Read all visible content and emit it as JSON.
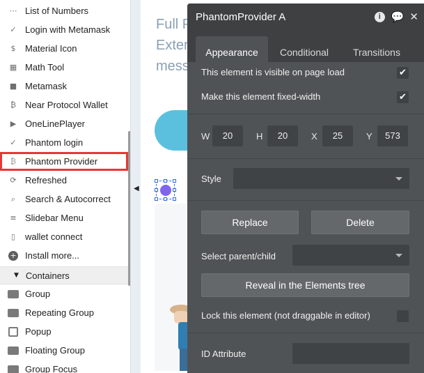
{
  "sidebar": {
    "items": [
      {
        "label": "List of Numbers",
        "icon": "ellipsis-icon",
        "glyph": "⋯"
      },
      {
        "label": "Login with Metamask",
        "icon": "check-circle-icon",
        "glyph": "✓"
      },
      {
        "label": "Material Icon",
        "icon": "dollar-icon",
        "glyph": "$"
      },
      {
        "label": "Math Tool",
        "icon": "calculator-icon",
        "glyph": "▦"
      },
      {
        "label": "Metamask",
        "icon": "square-icon",
        "glyph": "■"
      },
      {
        "label": "Near Protocol Wallet",
        "icon": "bitcoin-icon",
        "glyph": "₿"
      },
      {
        "label": "OneLinePlayer",
        "icon": "play-icon",
        "glyph": "▶"
      },
      {
        "label": "Phantom login",
        "icon": "check-circle-icon",
        "glyph": "✓"
      },
      {
        "label": "Phantom Provider",
        "icon": "bitcoin-icon",
        "glyph": "₿"
      },
      {
        "label": "Refreshed",
        "icon": "refresh-icon",
        "glyph": "⟳"
      },
      {
        "label": "Search & Autocorrect",
        "icon": "search-icon",
        "glyph": "⌕"
      },
      {
        "label": "Slidebar Menu",
        "icon": "menu-icon",
        "glyph": "≡"
      },
      {
        "label": "wallet connect",
        "icon": "phone-icon",
        "glyph": "▯"
      },
      {
        "label": "Install more...",
        "icon": "plus-circle-icon",
        "glyph": "+"
      }
    ],
    "section_header": "Containers",
    "containers": [
      {
        "label": "Group",
        "icon": "folder-icon"
      },
      {
        "label": "Repeating Group",
        "icon": "folder-icon"
      },
      {
        "label": "Popup",
        "icon": "popup-icon"
      },
      {
        "label": "Floating Group",
        "icon": "folder-icon"
      },
      {
        "label": "Group Focus",
        "icon": "folder-icon"
      }
    ]
  },
  "canvas": {
    "lines": [
      "Full P",
      "Exter",
      "mess"
    ]
  },
  "editor": {
    "title": "PhantomProvider A",
    "tabs": [
      "Appearance",
      "Conditional",
      "Transitions"
    ],
    "visible_on_load_label": "This element is visible on page load",
    "visible_on_load": true,
    "fixed_width_label": "Make this element fixed-width",
    "fixed_width": true,
    "dims": {
      "w_label": "W",
      "w": "20",
      "h_label": "H",
      "h": "20",
      "x_label": "X",
      "x": "25",
      "y_label": "Y",
      "y": "573"
    },
    "style_label": "Style",
    "replace_label": "Replace",
    "delete_label": "Delete",
    "parent_child_label": "Select parent/child",
    "reveal_label": "Reveal in the Elements tree",
    "lock_label": "Lock this element (not draggable in editor)",
    "lock": false,
    "id_attr_label": "ID Attribute"
  },
  "colors": {
    "editor_bg": "#505355",
    "editor_header": "#3e4042",
    "highlight": "#e53935",
    "selection": "#2d6ae3"
  }
}
